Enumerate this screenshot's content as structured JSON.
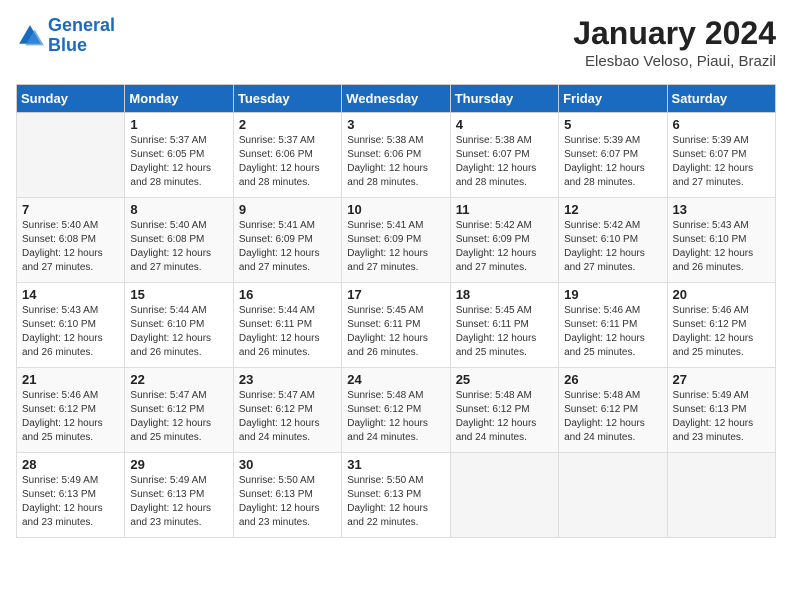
{
  "logo": {
    "line1": "General",
    "line2": "Blue"
  },
  "title": "January 2024",
  "location": "Elesbao Veloso, Piaui, Brazil",
  "headers": [
    "Sunday",
    "Monday",
    "Tuesday",
    "Wednesday",
    "Thursday",
    "Friday",
    "Saturday"
  ],
  "weeks": [
    [
      {
        "day": "",
        "info": ""
      },
      {
        "day": "1",
        "info": "Sunrise: 5:37 AM\nSunset: 6:05 PM\nDaylight: 12 hours\nand 28 minutes."
      },
      {
        "day": "2",
        "info": "Sunrise: 5:37 AM\nSunset: 6:06 PM\nDaylight: 12 hours\nand 28 minutes."
      },
      {
        "day": "3",
        "info": "Sunrise: 5:38 AM\nSunset: 6:06 PM\nDaylight: 12 hours\nand 28 minutes."
      },
      {
        "day": "4",
        "info": "Sunrise: 5:38 AM\nSunset: 6:07 PM\nDaylight: 12 hours\nand 28 minutes."
      },
      {
        "day": "5",
        "info": "Sunrise: 5:39 AM\nSunset: 6:07 PM\nDaylight: 12 hours\nand 28 minutes."
      },
      {
        "day": "6",
        "info": "Sunrise: 5:39 AM\nSunset: 6:07 PM\nDaylight: 12 hours\nand 27 minutes."
      }
    ],
    [
      {
        "day": "7",
        "info": "Sunrise: 5:40 AM\nSunset: 6:08 PM\nDaylight: 12 hours\nand 27 minutes."
      },
      {
        "day": "8",
        "info": "Sunrise: 5:40 AM\nSunset: 6:08 PM\nDaylight: 12 hours\nand 27 minutes."
      },
      {
        "day": "9",
        "info": "Sunrise: 5:41 AM\nSunset: 6:09 PM\nDaylight: 12 hours\nand 27 minutes."
      },
      {
        "day": "10",
        "info": "Sunrise: 5:41 AM\nSunset: 6:09 PM\nDaylight: 12 hours\nand 27 minutes."
      },
      {
        "day": "11",
        "info": "Sunrise: 5:42 AM\nSunset: 6:09 PM\nDaylight: 12 hours\nand 27 minutes."
      },
      {
        "day": "12",
        "info": "Sunrise: 5:42 AM\nSunset: 6:10 PM\nDaylight: 12 hours\nand 27 minutes."
      },
      {
        "day": "13",
        "info": "Sunrise: 5:43 AM\nSunset: 6:10 PM\nDaylight: 12 hours\nand 26 minutes."
      }
    ],
    [
      {
        "day": "14",
        "info": "Sunrise: 5:43 AM\nSunset: 6:10 PM\nDaylight: 12 hours\nand 26 minutes."
      },
      {
        "day": "15",
        "info": "Sunrise: 5:44 AM\nSunset: 6:10 PM\nDaylight: 12 hours\nand 26 minutes."
      },
      {
        "day": "16",
        "info": "Sunrise: 5:44 AM\nSunset: 6:11 PM\nDaylight: 12 hours\nand 26 minutes."
      },
      {
        "day": "17",
        "info": "Sunrise: 5:45 AM\nSunset: 6:11 PM\nDaylight: 12 hours\nand 26 minutes."
      },
      {
        "day": "18",
        "info": "Sunrise: 5:45 AM\nSunset: 6:11 PM\nDaylight: 12 hours\nand 25 minutes."
      },
      {
        "day": "19",
        "info": "Sunrise: 5:46 AM\nSunset: 6:11 PM\nDaylight: 12 hours\nand 25 minutes."
      },
      {
        "day": "20",
        "info": "Sunrise: 5:46 AM\nSunset: 6:12 PM\nDaylight: 12 hours\nand 25 minutes."
      }
    ],
    [
      {
        "day": "21",
        "info": "Sunrise: 5:46 AM\nSunset: 6:12 PM\nDaylight: 12 hours\nand 25 minutes."
      },
      {
        "day": "22",
        "info": "Sunrise: 5:47 AM\nSunset: 6:12 PM\nDaylight: 12 hours\nand 25 minutes."
      },
      {
        "day": "23",
        "info": "Sunrise: 5:47 AM\nSunset: 6:12 PM\nDaylight: 12 hours\nand 24 minutes."
      },
      {
        "day": "24",
        "info": "Sunrise: 5:48 AM\nSunset: 6:12 PM\nDaylight: 12 hours\nand 24 minutes."
      },
      {
        "day": "25",
        "info": "Sunrise: 5:48 AM\nSunset: 6:12 PM\nDaylight: 12 hours\nand 24 minutes."
      },
      {
        "day": "26",
        "info": "Sunrise: 5:48 AM\nSunset: 6:12 PM\nDaylight: 12 hours\nand 24 minutes."
      },
      {
        "day": "27",
        "info": "Sunrise: 5:49 AM\nSunset: 6:13 PM\nDaylight: 12 hours\nand 23 minutes."
      }
    ],
    [
      {
        "day": "28",
        "info": "Sunrise: 5:49 AM\nSunset: 6:13 PM\nDaylight: 12 hours\nand 23 minutes."
      },
      {
        "day": "29",
        "info": "Sunrise: 5:49 AM\nSunset: 6:13 PM\nDaylight: 12 hours\nand 23 minutes."
      },
      {
        "day": "30",
        "info": "Sunrise: 5:50 AM\nSunset: 6:13 PM\nDaylight: 12 hours\nand 23 minutes."
      },
      {
        "day": "31",
        "info": "Sunrise: 5:50 AM\nSunset: 6:13 PM\nDaylight: 12 hours\nand 22 minutes."
      },
      {
        "day": "",
        "info": ""
      },
      {
        "day": "",
        "info": ""
      },
      {
        "day": "",
        "info": ""
      }
    ]
  ]
}
